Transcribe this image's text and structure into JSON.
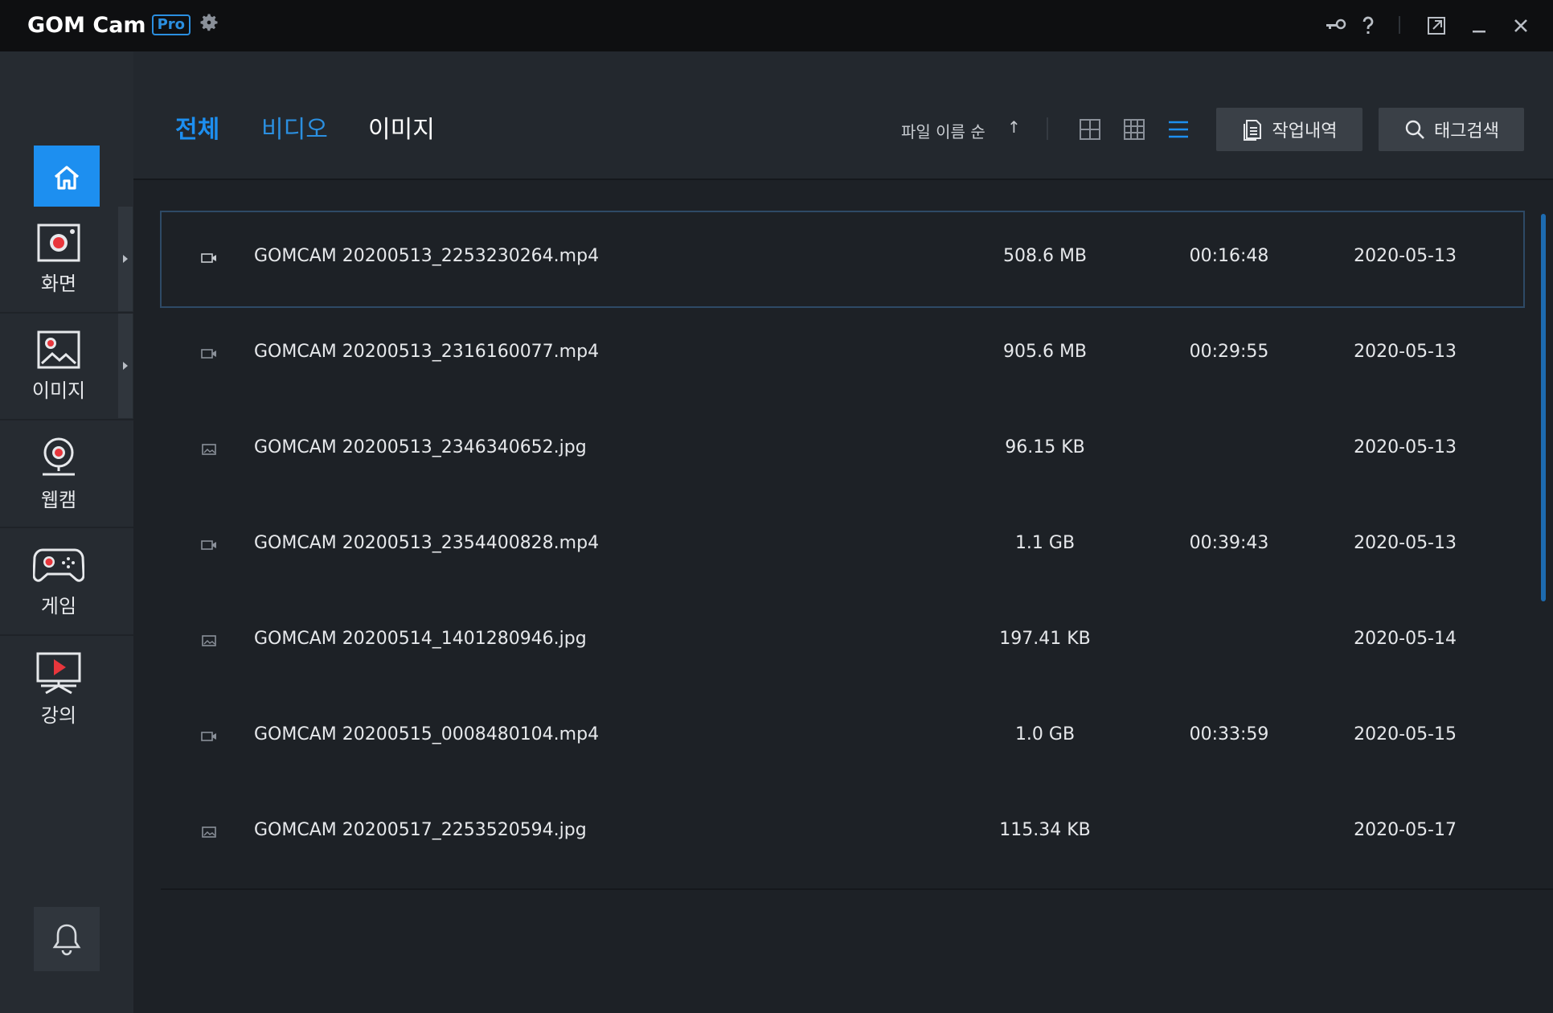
{
  "app": {
    "logo_text": "GOM Cam",
    "badge": "Pro"
  },
  "titlebar": {
    "icons": [
      "settings-gear-icon",
      "key-icon",
      "help-icon",
      "restore-icon",
      "minimize-icon",
      "close-icon"
    ]
  },
  "sidebar": {
    "home_icon": "home-icon",
    "items": [
      {
        "label": "화면",
        "icon": "screen-record-icon"
      },
      {
        "label": "이미지",
        "icon": "image-capture-icon"
      },
      {
        "label": "웹캠",
        "icon": "webcam-icon"
      },
      {
        "label": "게임",
        "icon": "gamepad-icon"
      },
      {
        "label": "강의",
        "icon": "lecture-icon"
      }
    ],
    "bell_icon": "bell-icon"
  },
  "header": {
    "tabs": [
      {
        "label": "전체",
        "active": true
      },
      {
        "label": "비디오",
        "active": false
      },
      {
        "label": "이미지",
        "active": false
      }
    ],
    "sort_label": "파일 이름 순",
    "sort_arrow": "↑",
    "view_modes": [
      "large-grid-view-icon",
      "small-grid-view-icon",
      "list-view-icon"
    ],
    "active_view": "list",
    "history_button": "작업내역",
    "tag_search_button": "태그검색"
  },
  "colors": {
    "accent": "#1d8ff0",
    "tab_inactive_blue": "#2b8fe0",
    "background": "#1d2126",
    "sidebar": "#262b31"
  },
  "files": [
    {
      "type": "video",
      "name": "GOMCAM 20200513_2253230264.mp4",
      "size": "508.6 MB",
      "duration": "00:16:48",
      "date": "2020-05-13",
      "selected": true
    },
    {
      "type": "video",
      "name": "GOMCAM 20200513_2316160077.mp4",
      "size": "905.6 MB",
      "duration": "00:29:55",
      "date": "2020-05-13"
    },
    {
      "type": "image",
      "name": "GOMCAM 20200513_2346340652.jpg",
      "size": "96.15 KB",
      "duration": "",
      "date": "2020-05-13"
    },
    {
      "type": "video",
      "name": "GOMCAM 20200513_2354400828.mp4",
      "size": "1.1 GB",
      "duration": "00:39:43",
      "date": "2020-05-13"
    },
    {
      "type": "image",
      "name": "GOMCAM 20200514_1401280946.jpg",
      "size": "197.41 KB",
      "duration": "",
      "date": "2020-05-14"
    },
    {
      "type": "video",
      "name": "GOMCAM 20200515_0008480104.mp4",
      "size": "1.0 GB",
      "duration": "00:33:59",
      "date": "2020-05-15"
    },
    {
      "type": "image",
      "name": "GOMCAM 20200517_2253520594.jpg",
      "size": "115.34 KB",
      "duration": "",
      "date": "2020-05-17"
    }
  ]
}
